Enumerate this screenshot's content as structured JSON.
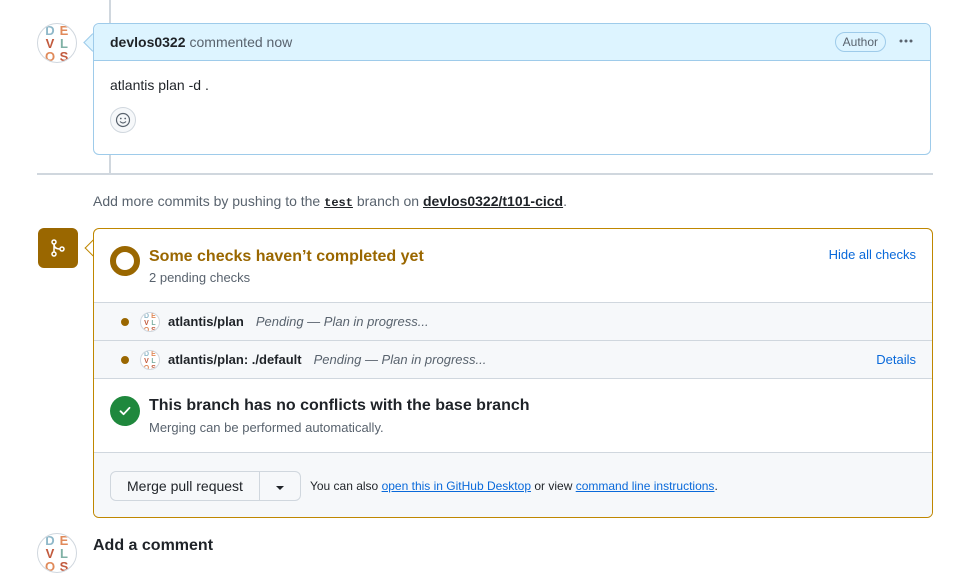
{
  "comment": {
    "author": "devlos0322",
    "meta": "commented now",
    "badge": "Author",
    "more_icon": "kebab-horizontal-icon",
    "body": "atlantis plan -d .",
    "reaction_icon": "smiley-icon"
  },
  "avatar": {
    "letters": [
      "D",
      "E",
      "V",
      "L",
      "O",
      "S"
    ]
  },
  "push_note": {
    "prefix": "Add more commits by pushing to the",
    "branch": "test",
    "middle": "branch on",
    "repo": "devlos0322/t101-cicd",
    "suffix": "."
  },
  "checks": {
    "title": "Some checks haven’t completed yet",
    "subtitle": "2 pending checks",
    "hide_label": "Hide all checks",
    "items": [
      {
        "name": "atlantis/plan",
        "status": "Pending — Plan in progress...",
        "details": ""
      },
      {
        "name": "atlantis/plan: ./default",
        "status": "Pending — Plan in progress...",
        "details": "Details"
      }
    ]
  },
  "conflicts": {
    "title": "This branch has no conflicts with the base branch",
    "subtitle": "Merging can be performed automatically."
  },
  "merge": {
    "button_label": "Merge pull request",
    "also_prefix": "You can also",
    "desktop_link": "open this in GitHub Desktop",
    "or_view": "or view",
    "cli_link": "command line instructions",
    "suffix": "."
  },
  "add_comment": {
    "title": "Add a comment"
  },
  "colors": {
    "pending": "#9a6700",
    "success": "#1f883d",
    "link": "#0969da",
    "comment_header_bg": "#ddf4ff"
  }
}
